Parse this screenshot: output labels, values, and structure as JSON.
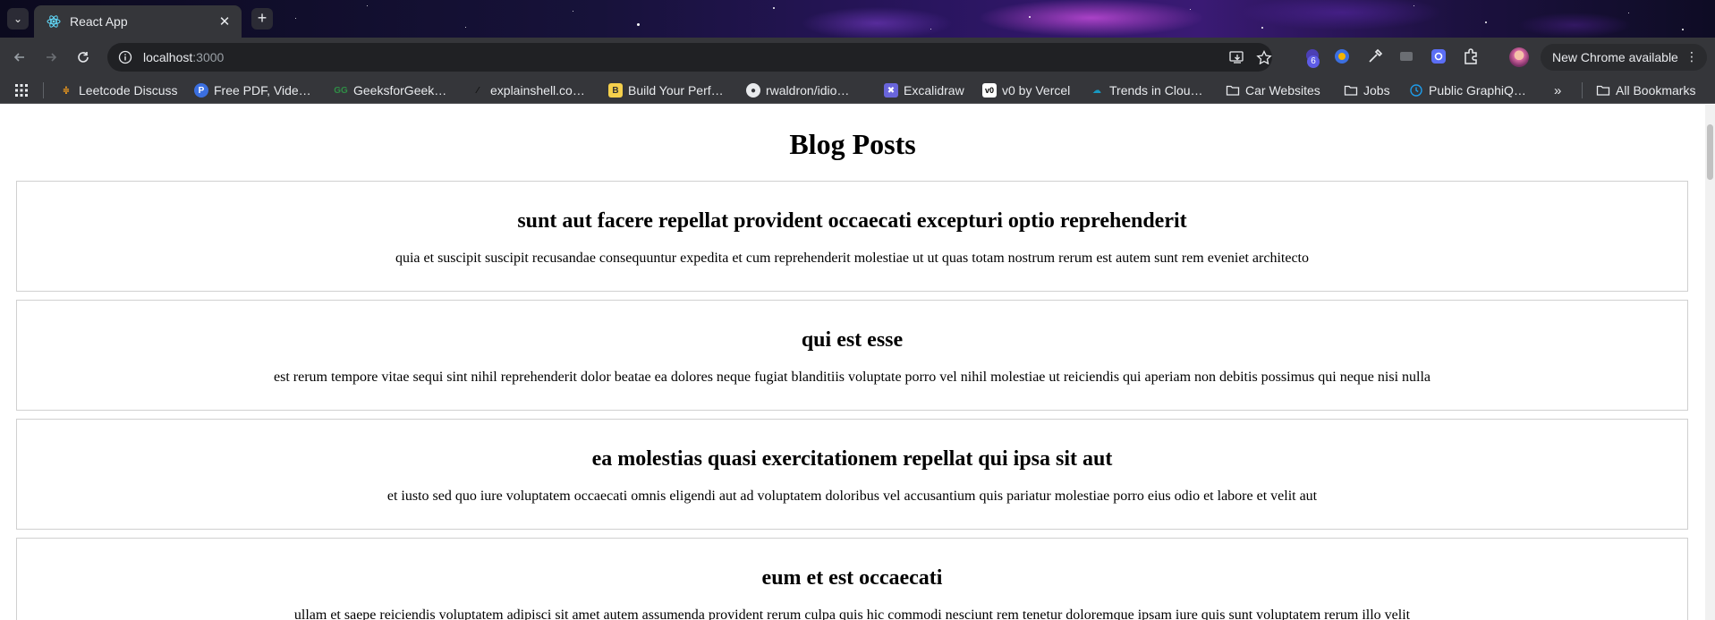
{
  "browser": {
    "tab": {
      "title": "React App"
    },
    "url": {
      "host": "localhost",
      "port": ":3000"
    },
    "extension_badge": "6",
    "update_button": "New Chrome available",
    "bookmarks": [
      {
        "label": "Leetcode Discuss",
        "icon": "leetcode-icon"
      },
      {
        "label": "Free PDF, Vide…",
        "icon": "pdf-site-icon"
      },
      {
        "label": "GeeksforGeek…",
        "icon": "geeksforgeeks-icon"
      },
      {
        "label": "explainshell.co…",
        "icon": "explainshell-icon"
      },
      {
        "label": "Build Your Perf…",
        "icon": "build-site-icon"
      },
      {
        "label": "rwaldron/idio…",
        "icon": "github-icon"
      },
      {
        "label": "Excalidraw",
        "icon": "excalidraw-icon"
      },
      {
        "label": "v0 by Vercel",
        "icon": "v0-icon"
      },
      {
        "label": "Trends in Clou…",
        "icon": "salesforce-icon"
      },
      {
        "label": "Car Websites",
        "icon": "folder-icon"
      },
      {
        "label": "Jobs",
        "icon": "folder-icon"
      },
      {
        "label": "Public GraphiQ…",
        "icon": "graphiql-icon"
      }
    ],
    "all_bookmarks": "All Bookmarks"
  },
  "page": {
    "title": "Blog Posts",
    "posts": [
      {
        "title": "sunt aut facere repellat provident occaecati excepturi optio reprehenderit",
        "body": "quia et suscipit suscipit recusandae consequuntur expedita et cum reprehenderit molestiae ut ut quas totam nostrum rerum est autem sunt rem eveniet architecto"
      },
      {
        "title": "qui est esse",
        "body": "est rerum tempore vitae sequi sint nihil reprehenderit dolor beatae ea dolores neque fugiat blanditiis voluptate porro vel nihil molestiae ut reiciendis qui aperiam non debitis possimus qui neque nisi nulla"
      },
      {
        "title": "ea molestias quasi exercitationem repellat qui ipsa sit aut",
        "body": "et iusto sed quo iure voluptatem occaecati omnis eligendi aut ad voluptatem doloribus vel accusantium quis pariatur molestiae porro eius odio et labore et velit aut"
      },
      {
        "title": "eum et est occaecati",
        "body": "ullam et saepe reiciendis voluptatem adipisci sit amet autem assumenda provident rerum culpa quis hic commodi nesciunt rem tenetur doloremque ipsam iure quis sunt voluptatem rerum illo velit"
      }
    ]
  }
}
